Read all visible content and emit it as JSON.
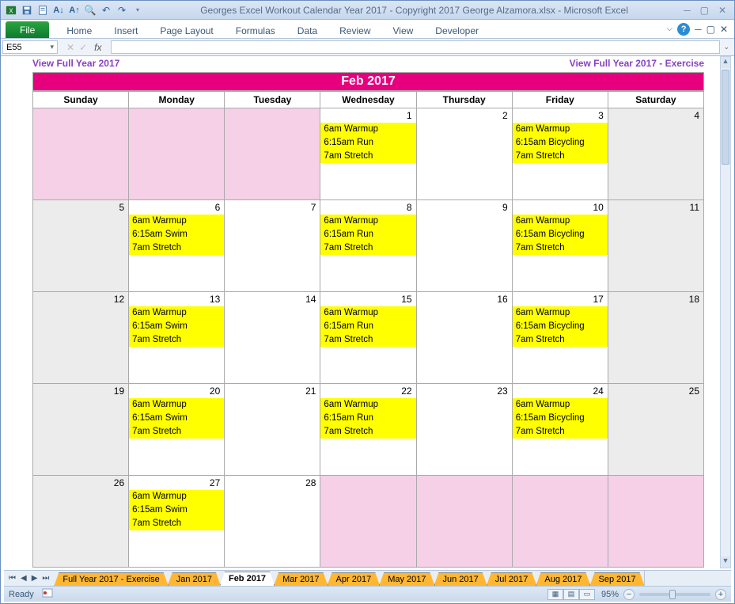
{
  "window": {
    "title": "Georges Excel Workout Calendar Year 2017  -  Copyright 2017 George Alzamora.xlsx  -  Microsoft Excel"
  },
  "ribbon": {
    "file": "File",
    "tabs": [
      "Home",
      "Insert",
      "Page Layout",
      "Formulas",
      "Data",
      "Review",
      "View",
      "Developer"
    ]
  },
  "namebox": "E55",
  "formula": "",
  "links": {
    "left": "View Full Year 2017",
    "right": "View Full Year 2017 - Exercise"
  },
  "calendar": {
    "title": "Feb 2017",
    "days": [
      "Sunday",
      "Monday",
      "Tuesday",
      "Wednesday",
      "Thursday",
      "Friday",
      "Saturday"
    ],
    "weeks": [
      [
        {
          "num": "",
          "cls": "pink"
        },
        {
          "num": "",
          "cls": "pink"
        },
        {
          "num": "",
          "cls": "pink"
        },
        {
          "num": "1",
          "events": [
            "6am Warmup",
            "6:15am Run",
            "7am Stretch"
          ]
        },
        {
          "num": "2"
        },
        {
          "num": "3",
          "events": [
            "6am Warmup",
            "6:15am Bicycling",
            "7am Stretch"
          ]
        },
        {
          "num": "4",
          "cls": "gray"
        }
      ],
      [
        {
          "num": "5",
          "cls": "gray"
        },
        {
          "num": "6",
          "events": [
            "6am Warmup",
            "6:15am Swim",
            "7am Stretch"
          ]
        },
        {
          "num": "7"
        },
        {
          "num": "8",
          "events": [
            "6am Warmup",
            "6:15am Run",
            "7am Stretch"
          ]
        },
        {
          "num": "9"
        },
        {
          "num": "10",
          "events": [
            "6am Warmup",
            "6:15am Bicycling",
            "7am Stretch"
          ]
        },
        {
          "num": "11",
          "cls": "gray"
        }
      ],
      [
        {
          "num": "12",
          "cls": "gray"
        },
        {
          "num": "13",
          "events": [
            "6am Warmup",
            "6:15am Swim",
            "7am Stretch"
          ]
        },
        {
          "num": "14"
        },
        {
          "num": "15",
          "events": [
            "6am Warmup",
            "6:15am Run",
            "7am Stretch"
          ]
        },
        {
          "num": "16"
        },
        {
          "num": "17",
          "events": [
            "6am Warmup",
            "6:15am Bicycling",
            "7am Stretch"
          ]
        },
        {
          "num": "18",
          "cls": "gray"
        }
      ],
      [
        {
          "num": "19",
          "cls": "gray"
        },
        {
          "num": "20",
          "events": [
            "6am Warmup",
            "6:15am Swim",
            "7am Stretch"
          ]
        },
        {
          "num": "21"
        },
        {
          "num": "22",
          "events": [
            "6am Warmup",
            "6:15am Run",
            "7am Stretch"
          ]
        },
        {
          "num": "23"
        },
        {
          "num": "24",
          "events": [
            "6am Warmup",
            "6:15am Bicycling",
            "7am Stretch"
          ]
        },
        {
          "num": "25",
          "cls": "gray"
        }
      ],
      [
        {
          "num": "26",
          "cls": "gray"
        },
        {
          "num": "27",
          "events": [
            "6am Warmup",
            "6:15am Swim",
            "7am Stretch"
          ]
        },
        {
          "num": "28"
        },
        {
          "num": "",
          "cls": "pink"
        },
        {
          "num": "",
          "cls": "pink"
        },
        {
          "num": "",
          "cls": "pink"
        },
        {
          "num": "",
          "cls": "pink"
        }
      ]
    ]
  },
  "sheet_tabs": [
    {
      "label": "Full Year 2017 - Exercise",
      "active": false
    },
    {
      "label": "Jan 2017",
      "active": false
    },
    {
      "label": "Feb 2017",
      "active": true
    },
    {
      "label": "Mar 2017",
      "active": false
    },
    {
      "label": "Apr 2017",
      "active": false
    },
    {
      "label": "May 2017",
      "active": false
    },
    {
      "label": "Jun 2017",
      "active": false
    },
    {
      "label": "Jul 2017",
      "active": false
    },
    {
      "label": "Aug 2017",
      "active": false
    },
    {
      "label": "Sep 2017",
      "active": false
    }
  ],
  "status": {
    "ready": "Ready",
    "zoom": "95%"
  }
}
